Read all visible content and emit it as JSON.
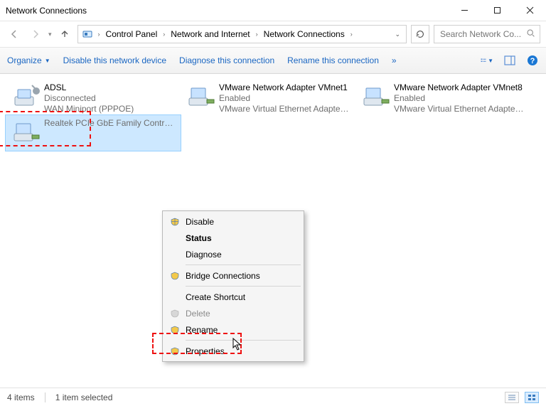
{
  "window": {
    "title": "Network Connections"
  },
  "breadcrumbs": {
    "a": "Control Panel",
    "b": "Network and Internet",
    "c": "Network Connections"
  },
  "search": {
    "placeholder": "Search Network Co..."
  },
  "commands": {
    "organize": "Organize",
    "disable": "Disable this network device",
    "diagnose": "Diagnose this connection",
    "rename": "Rename this connection",
    "more": "»"
  },
  "connections": {
    "adsl": {
      "name": "ADSL",
      "status": "Disconnected",
      "device": "WAN Miniport (PPPOE)"
    },
    "vmnet1": {
      "name": "VMware Network Adapter VMnet1",
      "status": "Enabled",
      "device": "VMware Virtual Ethernet Adapter ..."
    },
    "vmnet8": {
      "name": "VMware Network Adapter VMnet8",
      "status": "Enabled",
      "device": "VMware Virtual Ethernet Adapter ..."
    },
    "eth": {
      "name": "",
      "status": "",
      "device": "Realtek PCIe GbE Family Controll..."
    }
  },
  "context_menu": {
    "disable": "Disable",
    "status": "Status",
    "diagnose": "Diagnose",
    "bridge": "Bridge Connections",
    "shortcut": "Create Shortcut",
    "delete": "Delete",
    "rename": "Rename",
    "properties": "Properties"
  },
  "status": {
    "items": "4 items",
    "selected": "1 item selected"
  },
  "colors": {
    "link": "#1a66c2",
    "selection": "#cde8ff",
    "highlight_border": "#e11"
  }
}
